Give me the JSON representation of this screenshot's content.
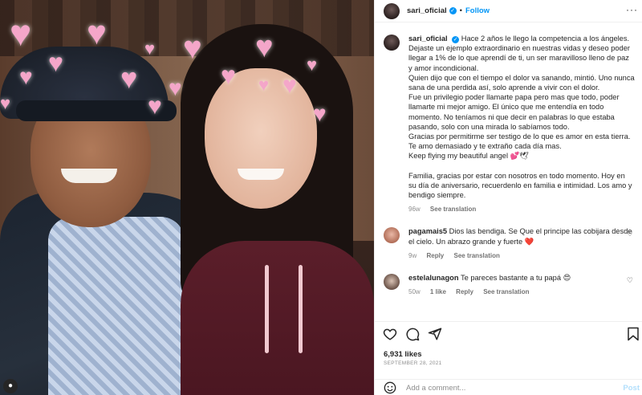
{
  "photo": {
    "heart_glyph": "♥",
    "avatar_icon": "person-icon"
  },
  "header": {
    "username": "sari_oficial",
    "verified_glyph": "✓",
    "separator": "•",
    "follow_label": "Follow",
    "more_glyph": "···"
  },
  "caption": {
    "username": "sari_oficial",
    "lines": [
      "Hace 2 años le llego la competencia a los ángeles. Dejaste un ejemplo extraordinario en nuestras vidas y deseo poder llegar a 1% de lo que aprendí de ti, un ser maravilloso lleno de paz y amor incondicional.",
      "Quien dijo que con el tiempo el dolor va sanando, mintió. Uno nunca sana de una perdida así, solo aprende a vivir con el dolor.",
      "Fue un privilegio poder llamarte papa pero mas que todo, poder llamarte mi mejor amigo. El único que me entendía en todo momento. No teníamos ni que decir en palabras lo que estaba pasando, solo con una mirada lo sabíamos todo.",
      "Gracias por permitirme ser testigo de lo que es amor en esta tierra.",
      "Te amo demasiado y te extraño cada día mas.",
      "Keep flying my beautiful angel 💕🕊"
    ],
    "para2": "Familia, gracias por estar con nosotros en todo momento. Hoy en su día de aniversario, recuerdenlo en familia e intimidad. Los amo y bendigo siempre.",
    "time": "96w",
    "translation": "See translation"
  },
  "comments": [
    {
      "username": "pagamais5",
      "text": "Dios las bendiga. Se Que el principe las cobijara desde el cielo. Un abrazo grande y fuerte ❤️",
      "time": "9w",
      "likes": "",
      "reply": "Reply",
      "translation": "See translation"
    },
    {
      "username": "estelalunagon",
      "text": "Te pareces bastante a tu papá 😍",
      "time": "50w",
      "likes": "1 like",
      "reply": "Reply",
      "translation": "See translation"
    }
  ],
  "actions": {
    "likes": "6,931 likes",
    "date": "SEPTEMBER 28, 2021",
    "comment_placeholder": "Add a comment...",
    "post_label": "Post"
  },
  "colors": {
    "accent": "#0095f6",
    "heart": "#f4a6c9",
    "hoodie": "#5b1e2a"
  }
}
